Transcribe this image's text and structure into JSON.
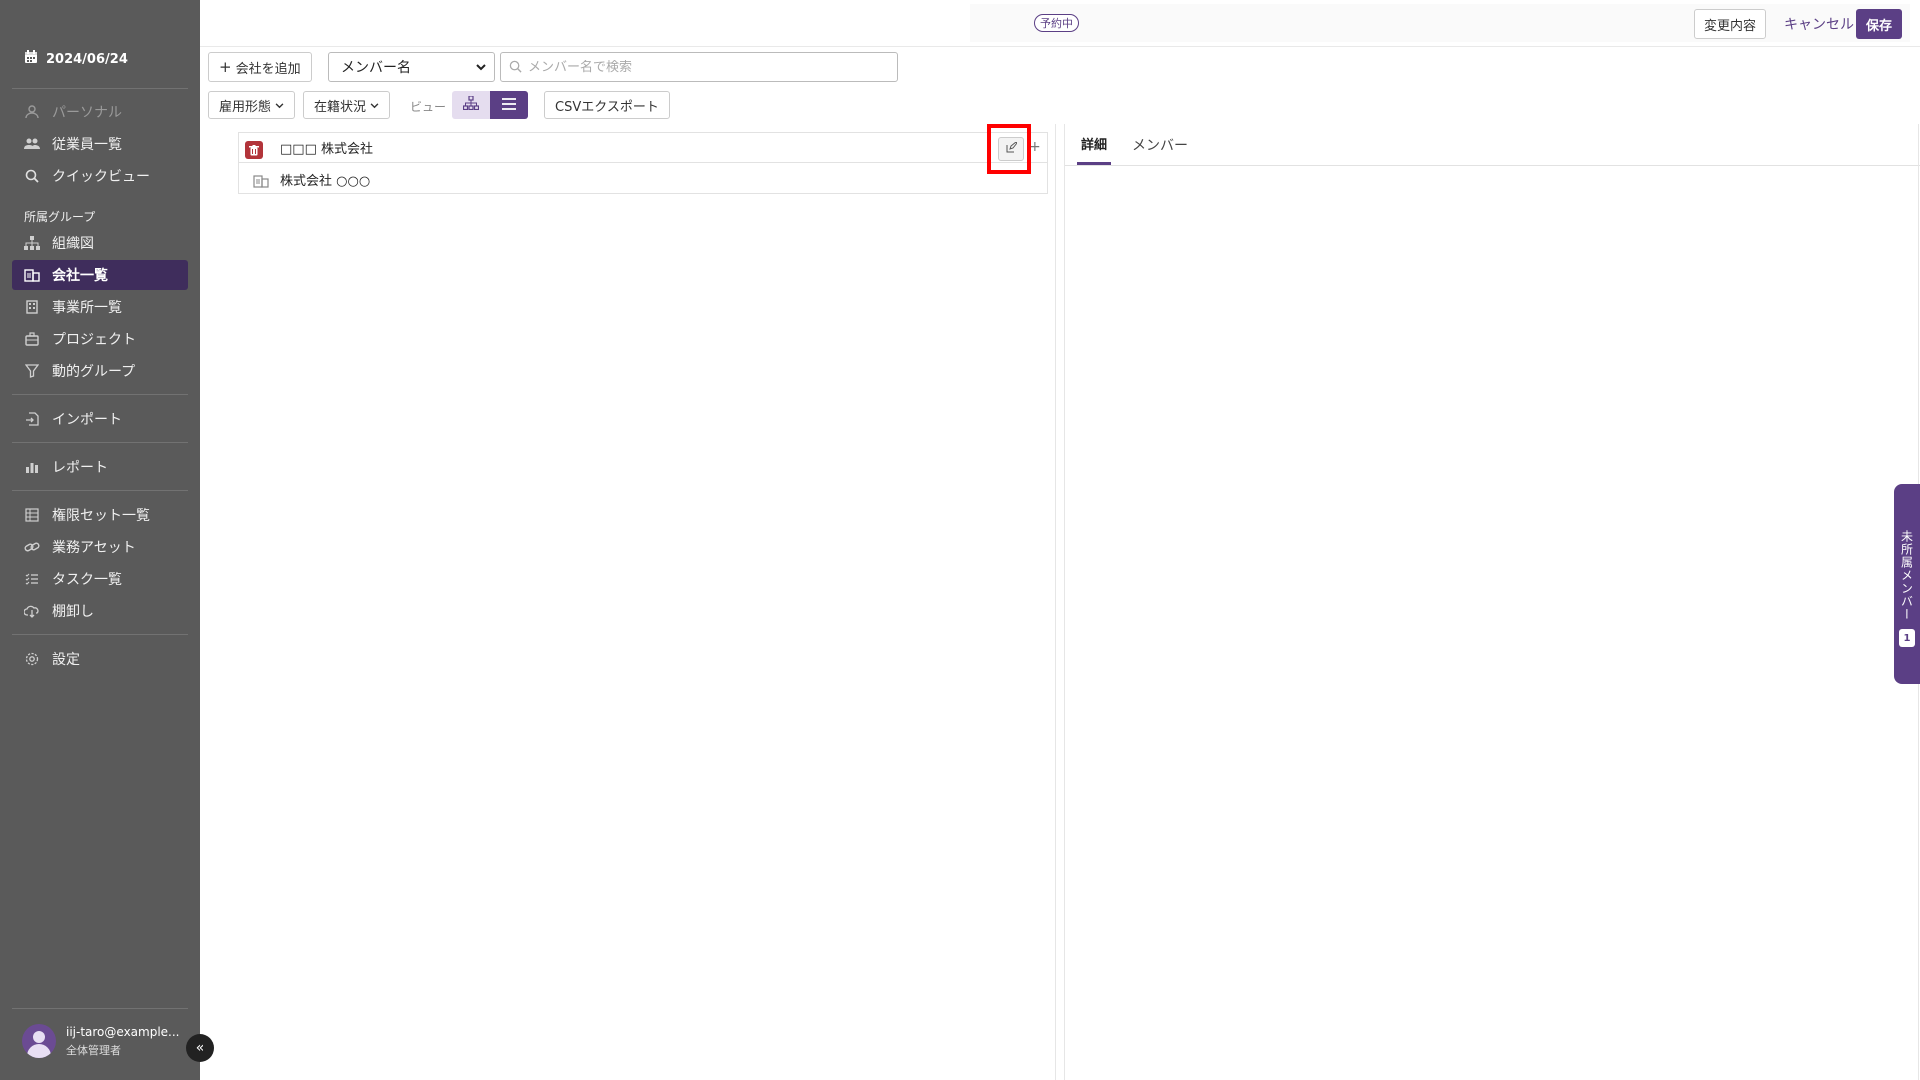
{
  "sidebar": {
    "date": "2024/06/24",
    "items_top": [
      {
        "label": "パーソナル"
      },
      {
        "label": "従業員一覧"
      },
      {
        "label": "クイックビュー"
      }
    ],
    "section_group": "所属グループ",
    "items_group": [
      {
        "label": "組織図"
      },
      {
        "label": "会社一覧"
      },
      {
        "label": "事業所一覧"
      },
      {
        "label": "プロジェクト"
      },
      {
        "label": "動的グループ"
      }
    ],
    "import": "インポート",
    "report": "レポート",
    "items_admin": [
      {
        "label": "権限セット一覧"
      },
      {
        "label": "業務アセット"
      },
      {
        "label": "タスク一覧"
      },
      {
        "label": "棚卸し"
      }
    ],
    "settings": "設定",
    "user": {
      "email": "iij-taro@example...",
      "role": "全体管理者"
    }
  },
  "topbar": {
    "badge": "予約中",
    "changes": "変更内容",
    "cancel": "キャンセル",
    "save": "保存"
  },
  "toolbar": {
    "add_company": "会社を追加",
    "search_field_select": "メンバー名",
    "search_placeholder": "メンバー名で検索",
    "employment_type": "雇用形態",
    "enrollment_status": "在籍状況",
    "view_label": "ビュー",
    "csv_export": "CSVエクスポート"
  },
  "tree": {
    "rows": [
      {
        "name": "□□□ 株式会社"
      },
      {
        "name": "株式会社 ○○○"
      }
    ]
  },
  "detail": {
    "tabs": [
      {
        "label": "詳細"
      },
      {
        "label": "メンバー"
      }
    ]
  },
  "drawer": {
    "label": "未所属メンバー",
    "count": "1"
  }
}
